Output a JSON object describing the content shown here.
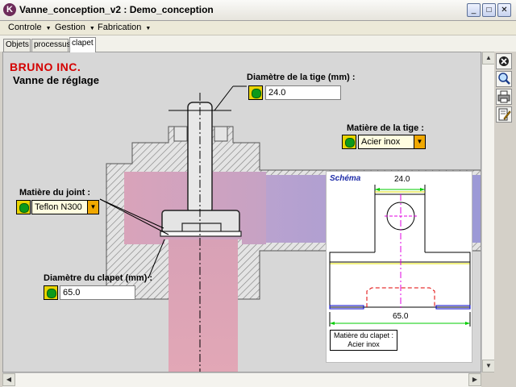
{
  "window": {
    "app_icon_letter": "K",
    "title": "Vanne_conception_v2 : Demo_conception",
    "minimize_glyph": "_",
    "maximize_glyph": "□",
    "close_glyph": "✕"
  },
  "menu": [
    {
      "label": "Controle"
    },
    {
      "label": "Gestion"
    },
    {
      "label": "Fabrication"
    }
  ],
  "menu_arrow": "▼",
  "tabs": [
    {
      "label": "Objets",
      "active": false
    },
    {
      "label": "processus",
      "active": false
    },
    {
      "label": "clapet",
      "active": true
    }
  ],
  "header": {
    "brand": "BRUNO INC.",
    "subtitle": "Vanne de réglage"
  },
  "fields": {
    "tige_diameter": {
      "label": "Diamètre de la tige (mm) :",
      "value": "24.0"
    },
    "tige_material": {
      "label": "Matière de la tige :",
      "value": "Acier inox"
    },
    "joint_material": {
      "label": "Matière du joint :",
      "value": "Teflon N300"
    },
    "clapet_diameter": {
      "label": "Diamètre du clapet (mm) :",
      "value": "65.0"
    }
  },
  "combo_arrow": "▼",
  "schema": {
    "label": "Schéma",
    "dim_top": "24.0",
    "dim_bottom": "65.0",
    "material_title": "Matière du clapet :",
    "material_value": "Acier inox"
  },
  "tools": [
    {
      "icon": "close-icon"
    },
    {
      "icon": "zoom-icon"
    },
    {
      "icon": "print-icon"
    },
    {
      "icon": "edit-icon"
    }
  ],
  "colors": {
    "brand": "#d40000",
    "indicator_yellow": "#e9d400",
    "indicator_green": "#0c9a1a",
    "combo_button": "#f0a800",
    "schema_label": "#1e2ca8"
  }
}
